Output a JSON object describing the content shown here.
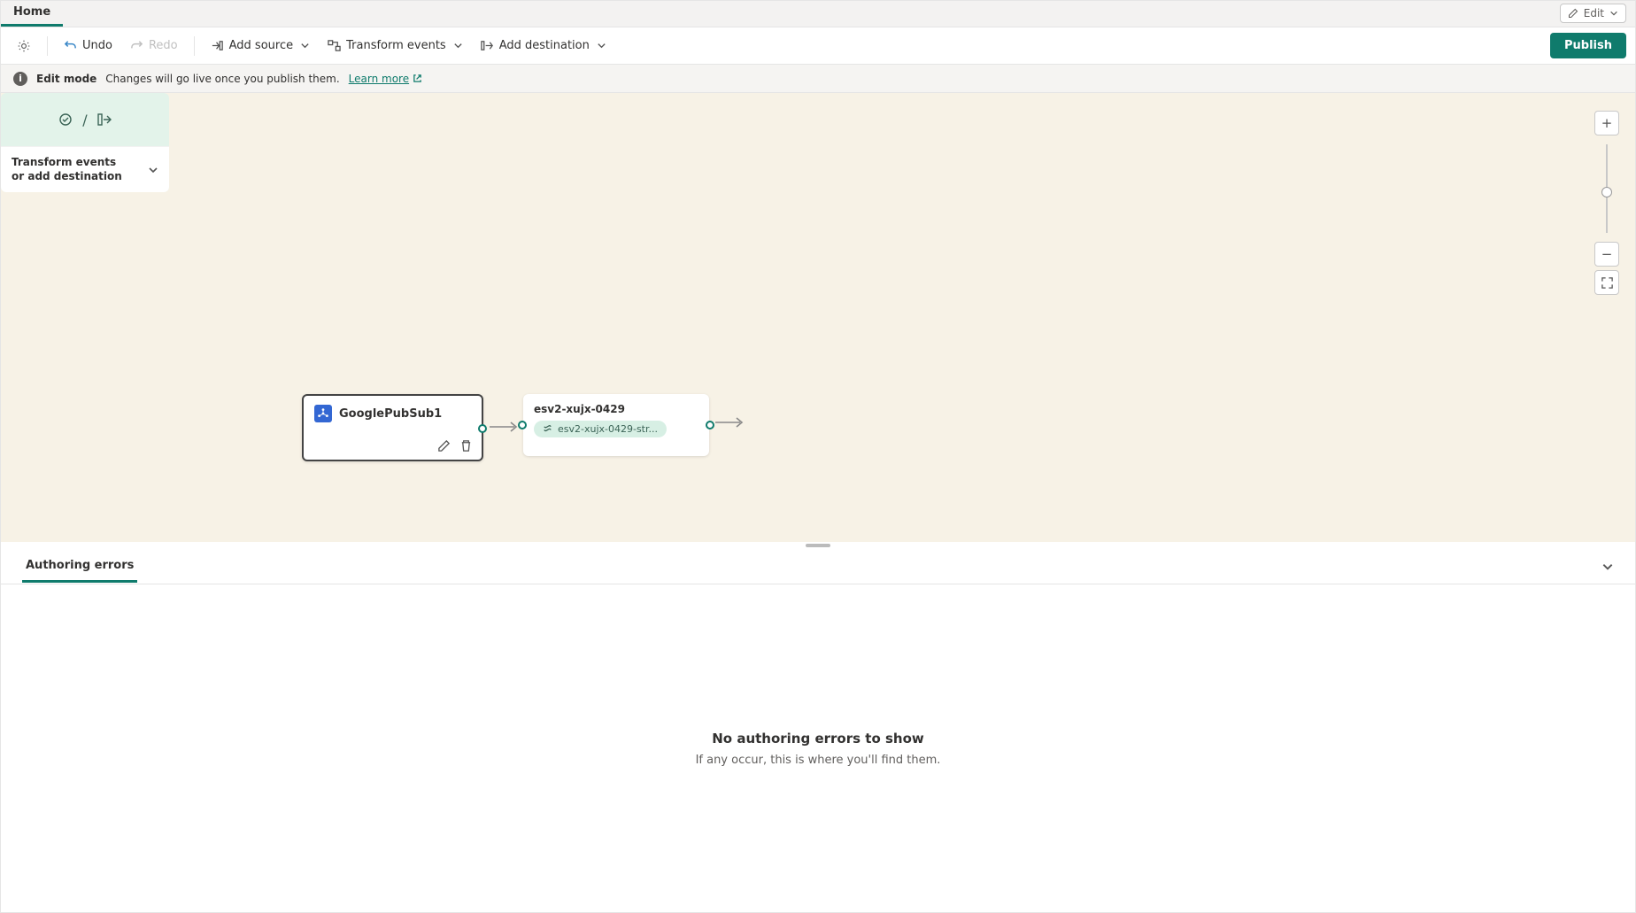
{
  "tabs": {
    "home": "Home"
  },
  "edit_dropdown": "Edit",
  "toolbar": {
    "undo": "Undo",
    "redo": "Redo",
    "add_source": "Add source",
    "transform": "Transform events",
    "add_dest": "Add destination",
    "publish": "Publish"
  },
  "info": {
    "mode": "Edit mode",
    "msg": "Changes will go live once you publish them.",
    "learn": "Learn more"
  },
  "nodes": {
    "source": {
      "title": "GooglePubSub1"
    },
    "stream": {
      "title": "esv2-xujx-0429",
      "chip": "esv2-xujx-0429-str..."
    },
    "dest": {
      "prompt": "Transform events or add destination"
    }
  },
  "panel": {
    "tab": "Authoring errors",
    "empty_title": "No authoring errors to show",
    "empty_sub": "If any occur, this is where you'll find them."
  }
}
